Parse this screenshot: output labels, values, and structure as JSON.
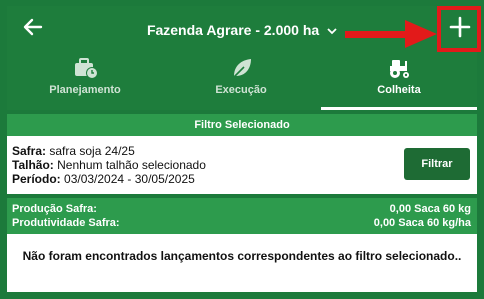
{
  "header": {
    "title": "Fazenda Agrare - 2.000 ha"
  },
  "tabs": [
    {
      "label": "Planejamento",
      "icon": "briefcase-clock-icon"
    },
    {
      "label": "Execução",
      "icon": "leaf-icon"
    },
    {
      "label": "Colheita",
      "icon": "tractor-icon"
    }
  ],
  "filter": {
    "heading": "Filtro Selecionado",
    "safra_label": "Safra:",
    "safra_value": "safra soja 24/25",
    "talhao_label": "Talhão:",
    "talhao_value": "Nenhum talhão selecionado",
    "periodo_label": "Período:",
    "periodo_value": "03/03/2024 - 30/05/2025",
    "button_label": "Filtrar"
  },
  "summary": {
    "producao_label": "Produção Safra:",
    "producao_value": "0,00 Saca 60 kg",
    "produtividade_label": "Produtividade Safra:",
    "produtividade_value": "0,00 Saca 60 kg/ha"
  },
  "empty_message": "Não foram encontrados lançamentos correspondentes ao filtro selecionado..",
  "colors": {
    "primary": "#1e7d3c",
    "accent": "#2d9b4d",
    "button": "#1e6b34",
    "highlight": "#e21a1a"
  }
}
